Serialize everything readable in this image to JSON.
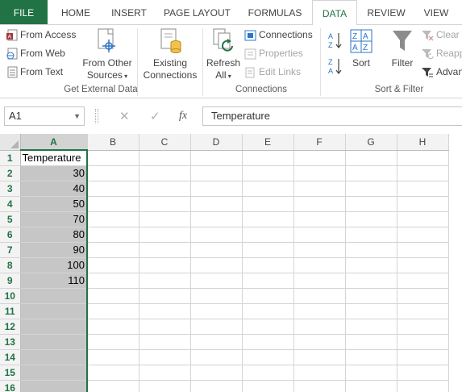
{
  "tabs": {
    "file": "FILE",
    "home": "HOME",
    "insert": "INSERT",
    "page_layout": "PAGE LAYOUT",
    "formulas": "FORMULAS",
    "data": "DATA",
    "review": "REVIEW",
    "view": "VIEW"
  },
  "ribbon": {
    "get_external": {
      "label": "Get External Data",
      "from_access": "From Access",
      "from_web": "From Web",
      "from_text": "From Text",
      "from_other_line1": "From Other",
      "from_other_line2": "Sources",
      "existing_line1": "Existing",
      "existing_line2": "Connections"
    },
    "connections": {
      "label": "Connections",
      "refresh_line1": "Refresh",
      "refresh_line2": "All",
      "connections": "Connections",
      "properties": "Properties",
      "edit_links": "Edit Links"
    },
    "sort_filter": {
      "label": "Sort & Filter",
      "sort": "Sort",
      "filter": "Filter",
      "clear": "Clear",
      "reapply": "Reapply",
      "advanced": "Advanced"
    }
  },
  "formula_bar": {
    "name_box": "A1",
    "fx": "fx",
    "content": "Temperature"
  },
  "sheet": {
    "columns": [
      "A",
      "B",
      "C",
      "D",
      "E",
      "F",
      "G",
      "H"
    ],
    "rows": [
      "1",
      "2",
      "3",
      "4",
      "5",
      "6",
      "7",
      "8",
      "9",
      "10",
      "11",
      "12",
      "13",
      "14",
      "15",
      "16"
    ],
    "column_a": [
      "Temperature",
      "30",
      "40",
      "50",
      "70",
      "80",
      "90",
      "100",
      "110",
      "",
      "",
      "",
      "",
      "",
      "",
      ""
    ]
  },
  "colors": {
    "accent": "#217346",
    "selection": "#c6c6c6"
  }
}
